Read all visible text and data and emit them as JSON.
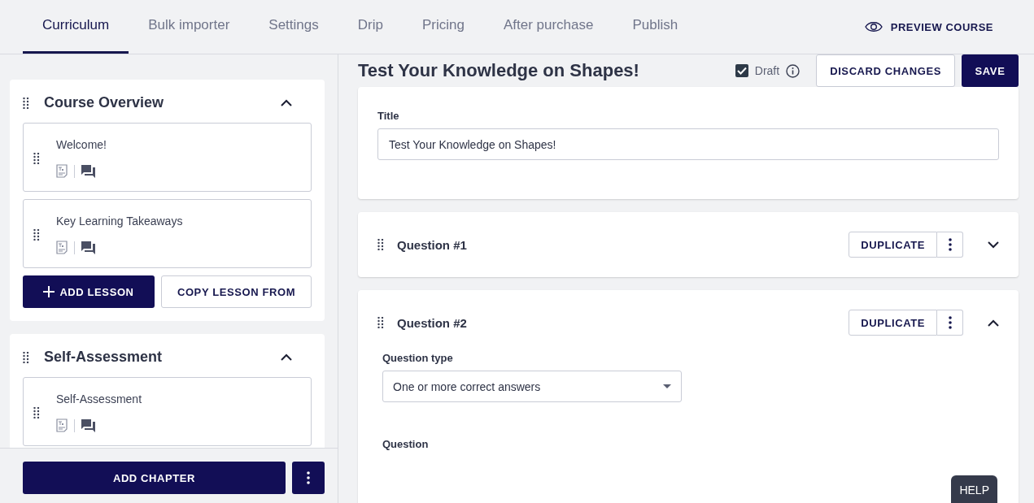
{
  "tabs": [
    {
      "label": "Curriculum",
      "selected": true
    },
    {
      "label": "Bulk importer",
      "selected": false
    },
    {
      "label": "Settings",
      "selected": false
    },
    {
      "label": "Drip",
      "selected": false
    },
    {
      "label": "Pricing",
      "selected": false
    },
    {
      "label": "After purchase",
      "selected": false
    },
    {
      "label": "Publish",
      "selected": false
    }
  ],
  "preview_button": "PREVIEW COURSE",
  "chapters": [
    {
      "title": "Course Overview",
      "expanded": true,
      "lessons": [
        {
          "title": "Welcome!"
        },
        {
          "title": "Key Learning Takeaways"
        }
      ],
      "add_lesson": "ADD LESSON",
      "copy_lesson": "COPY LESSON FROM"
    },
    {
      "title": "Self-Assessment",
      "expanded": true,
      "lessons": [
        {
          "title": "Self-Assessment"
        }
      ]
    }
  ],
  "add_chapter": "ADD CHAPTER",
  "editor": {
    "heading": "Test Your Knowledge on Shapes!",
    "draft": {
      "label": "Draft",
      "checked": true
    },
    "discard": "DISCARD CHANGES",
    "save": "SAVE",
    "title_field": {
      "label": "Title",
      "value": "Test Your Knowledge on Shapes!"
    },
    "questions": [
      {
        "title": "Question #1",
        "duplicate": "DUPLICATE",
        "expanded": false
      },
      {
        "title": "Question #2",
        "duplicate": "DUPLICATE",
        "expanded": true,
        "type_label": "Question type",
        "type_value": "One or more correct answers",
        "question_label": "Question"
      }
    ]
  },
  "help": "HELP"
}
